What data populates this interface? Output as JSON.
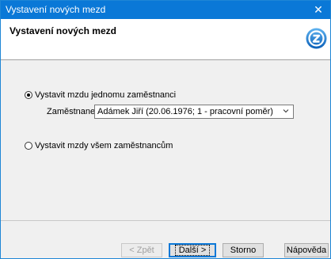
{
  "window": {
    "title": "Vystavení nových mezd",
    "close_glyph": "✕"
  },
  "header": {
    "title": "Vystavení nových mezd",
    "logo_icon": "circular-arrow-logo-icon"
  },
  "options": {
    "single": {
      "label": "Vystavit mzdu jednomu zaměstnanci",
      "selected": true
    },
    "all": {
      "label": "Vystavit mzdy všem zaměstnancům",
      "selected": false
    }
  },
  "employee": {
    "label": "Zaměstnanec",
    "value": "Adámek Jiří (20.06.1976; 1 - pracovní poměr)"
  },
  "buttons": {
    "back": "< Zpět",
    "next": "Další >",
    "cancel": "Storno",
    "help": "Nápověda"
  },
  "colors": {
    "accent": "#0a78d7",
    "background": "#f0f0f0"
  }
}
